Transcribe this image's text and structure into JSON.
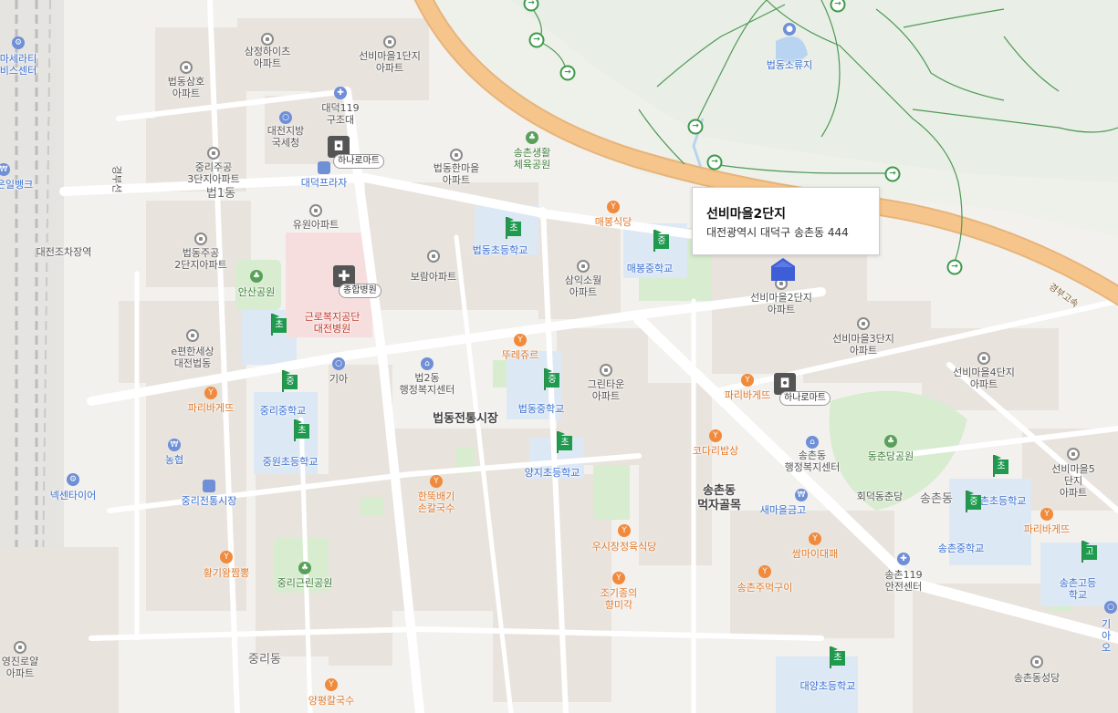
{
  "popup": {
    "title": "선비마을2단지",
    "address": "대전광역시 대덕구 송촌동 444"
  },
  "colors": {
    "highway": "#f6c58c",
    "park": "#d8ecd0",
    "school": "#dde8f5",
    "hospital": "#f7dede",
    "road": "#ffffff",
    "block": "#e8e3dd",
    "marker": "#3d5ed6",
    "trail": "#3e9a4c"
  },
  "map": {
    "highway_label": "경부고속",
    "areas": [
      "법1동",
      "법동전통시장",
      "송촌동\n먹자골목",
      "송촌동",
      "중리동",
      "대전조차장역",
      "경부선"
    ],
    "apartments": [
      "삼정하이츠\n아파트",
      "선비마을1단지\n아파트",
      "법동삼호\n아파트",
      "중리주공\n3단지아파트",
      "법동한마을\n아파트",
      "유원아파트",
      "법동주공\n2단지아파트",
      "보람아파트",
      "삼익소월\n아파트",
      "e편한세상\n대전법동",
      "그린타운\n아파트",
      "선비마을2단지\n아파트",
      "선비마을3단지\n아파트",
      "선비마을4단지\n아파트",
      "선비마을5단지\n아파트",
      "영진로얄\n아파트"
    ],
    "facilities": [
      "대덕119\n구조대",
      "대전지방\n국세청",
      "대덕프라자",
      "근로복지공단\n대전병원",
      "기아",
      "법2동\n행정복지센터",
      "송촌동\n행정복지센터",
      "송촌119\n안전센터",
      "새마을금고",
      "농협",
      "넥센타이어",
      "중리전통시장",
      "마세라티\n비스센터",
      "은일뱅크",
      "송촌동성당",
      "기아오",
      "회덕동춘당"
    ],
    "parks": [
      "송촌생활\n체육공원",
      "법동소류지",
      "안산공원",
      "동춘당공원",
      "중리근린공원"
    ],
    "schools": [
      "법동초등학교",
      "매봉중학교",
      "중리중학교",
      "중원초등학교",
      "법동중학교",
      "양지초등학교",
      "송촌중학교",
      "송촌고등학교",
      "대양초등학교",
      "송촌초등학교"
    ],
    "school_flags": [
      "초",
      "중",
      "초",
      "중",
      "초",
      "중",
      "초",
      "초",
      "중",
      "고",
      "초"
    ],
    "restaurants": [
      "매봉식당",
      "뚜레쥬르",
      "파리바게뜨",
      "파리바게뜨",
      "코다리밥상",
      "한뚝배기\n손칼국수",
      "우시장정육식당",
      "조기종의\n향미각",
      "쌈마이대패",
      "송촌주먹구이",
      "황기왕짬뽕",
      "양평칼국수",
      "파리바게뜨"
    ],
    "marts": [
      "하나로마트",
      "하나로마트"
    ],
    "hospital_tag": "종합병원"
  }
}
